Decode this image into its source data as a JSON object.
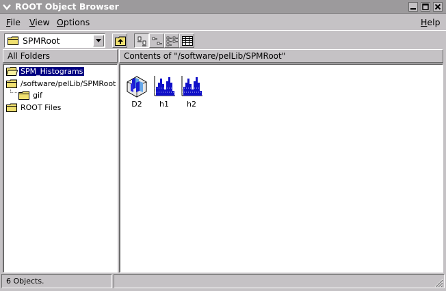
{
  "window": {
    "title": "ROOT Object Browser"
  },
  "menubar": {
    "file_rest": "ile",
    "file_key": "F",
    "view_rest": "iew",
    "view_key": "V",
    "options_rest": "ptions",
    "options_key": "O",
    "help_rest": "elp",
    "help_key": "H"
  },
  "toolbar": {
    "combo_value": "SPMRoot"
  },
  "left_header": "All Folders",
  "right_header": "Contents of \"/software/pelLib/SPMRoot\"",
  "tree": [
    {
      "label": "SPM_Histograms"
    },
    {
      "label": "/software/pelLib/SPMRoot"
    },
    {
      "label": "gif"
    },
    {
      "label": "ROOT Files"
    }
  ],
  "objects": [
    {
      "label": "D2",
      "icon": "lego-2d-histogram-icon"
    },
    {
      "label": "h1",
      "icon": "histogram-icon"
    },
    {
      "label": "h2",
      "icon": "histogram-icon"
    }
  ],
  "status": {
    "text": "6 Objects."
  },
  "colors": {
    "titlebar": "#9c9a9c",
    "selection": "#000080",
    "histogram": "#1010c8",
    "folder": "#f0e070"
  }
}
